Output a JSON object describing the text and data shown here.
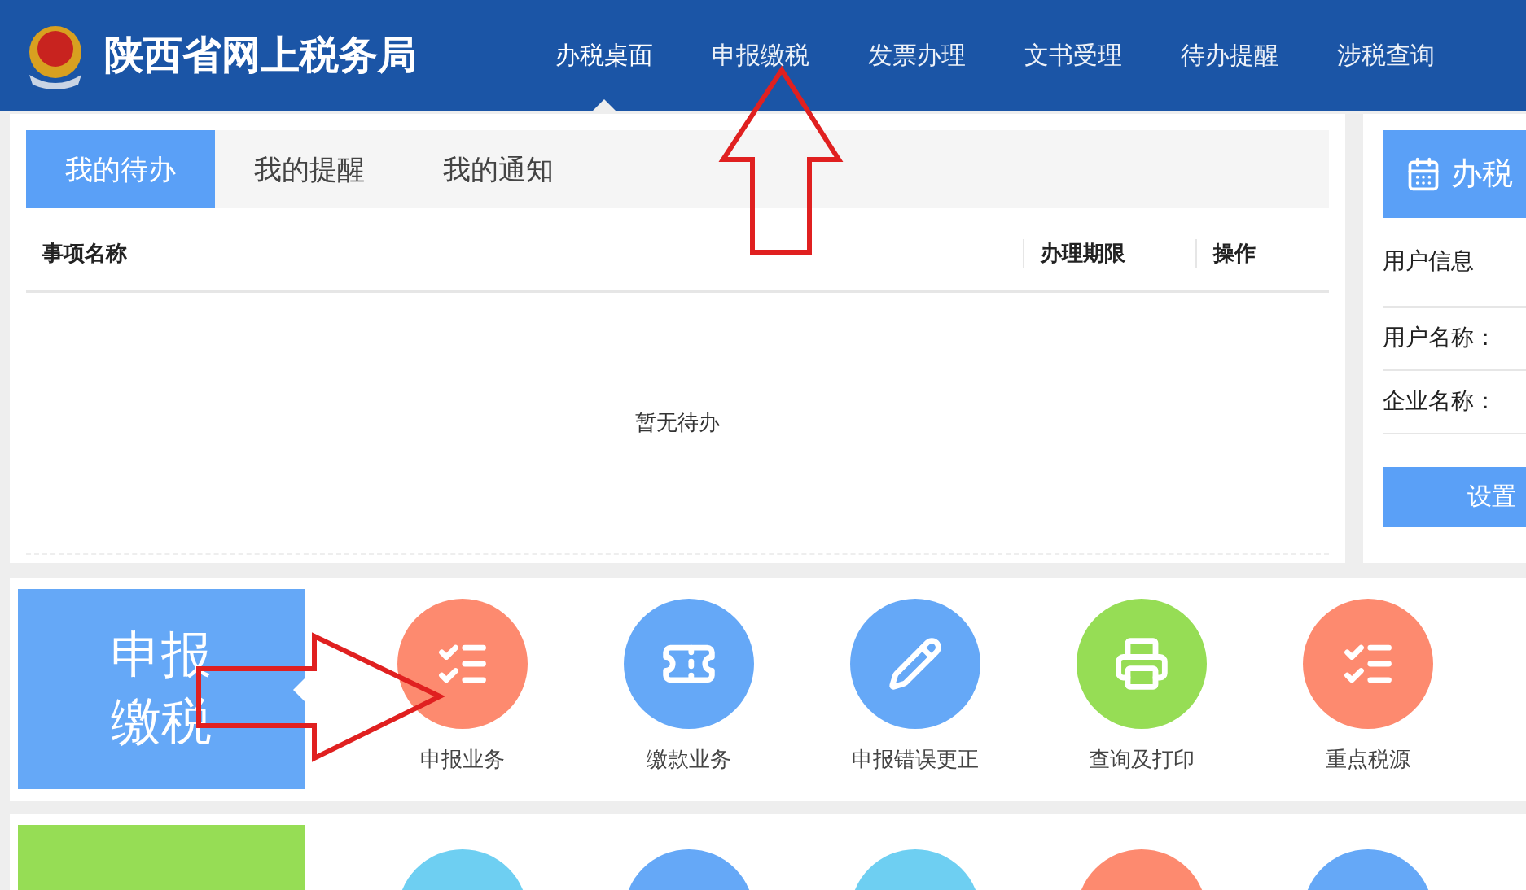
{
  "header": {
    "title": "陕西省网上税务局",
    "nav": [
      {
        "label": "办税桌面",
        "selected": true
      },
      {
        "label": "申报缴税",
        "selected": false
      },
      {
        "label": "发票办理",
        "selected": false
      },
      {
        "label": "文书受理",
        "selected": false
      },
      {
        "label": "待办提醒",
        "selected": false
      },
      {
        "label": "涉税查询",
        "selected": false
      }
    ]
  },
  "tasks": {
    "tabs": [
      {
        "label": "我的待办",
        "selected": true
      },
      {
        "label": "我的提醒",
        "selected": false
      },
      {
        "label": "我的通知",
        "selected": false
      }
    ],
    "columns": [
      "事项名称",
      "办理期限",
      "操作"
    ],
    "empty": "暂无待办"
  },
  "side": {
    "title": "办税",
    "section": "用户信息",
    "fields": [
      "用户名称：",
      "企业名称："
    ],
    "button": "设置"
  },
  "declare": {
    "title": "申报缴税",
    "tiles": [
      {
        "label": "申报业务",
        "kind": "list",
        "color": "#fd8a6f"
      },
      {
        "label": "缴款业务",
        "kind": "ticket",
        "color": "#65a8f7"
      },
      {
        "label": "申报错误更正",
        "kind": "pencil",
        "color": "#65a8f7"
      },
      {
        "label": "查询及打印",
        "kind": "printer",
        "color": "#96dd55"
      },
      {
        "label": "重点税源",
        "kind": "list",
        "color": "#fd8a6f"
      }
    ]
  },
  "invoice": {
    "tiles": [
      {
        "color": "#6ecff2"
      },
      {
        "color": "#65a8f7"
      },
      {
        "color": "#6ecff2"
      },
      {
        "color": "#fd8a6f"
      },
      {
        "color": "#65a8f7"
      }
    ]
  }
}
